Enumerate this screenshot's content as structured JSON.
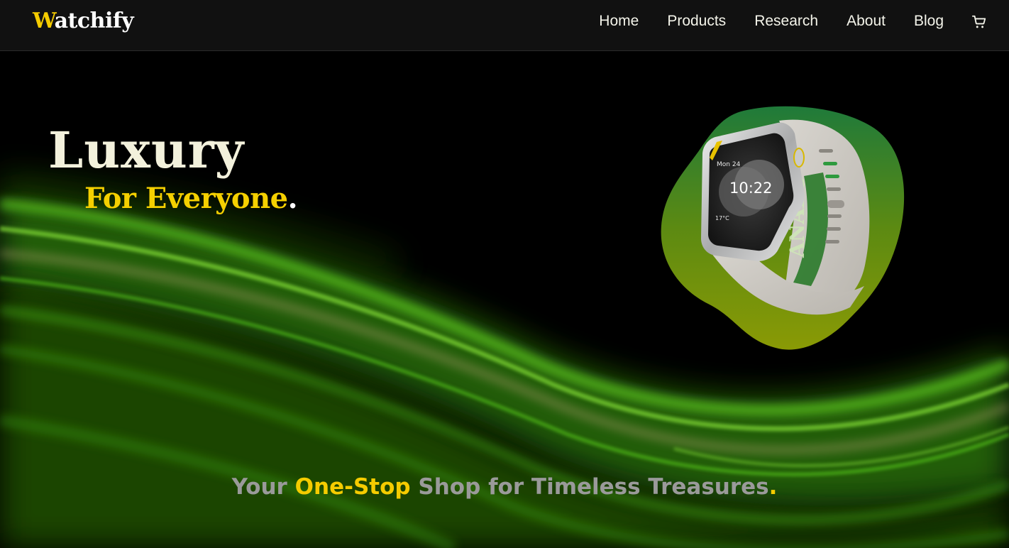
{
  "brand": {
    "logo_first": "W",
    "logo_rest": "atchify",
    "accent_color": "#f5cc00"
  },
  "nav": {
    "items": [
      {
        "label": "Home"
      },
      {
        "label": "Products"
      },
      {
        "label": "Research"
      },
      {
        "label": "About"
      },
      {
        "label": "Blog"
      }
    ],
    "cart_icon": "cart-icon"
  },
  "hero": {
    "title": "Luxury",
    "subtitle": "For Everyone",
    "subtitle_dot": ".",
    "tagline_part1": "Your ",
    "tagline_highlight": "One-Stop",
    "tagline_part2": " Shop for Timeless Treasures",
    "tagline_dot": "."
  },
  "watch": {
    "brand_text": "ANARC",
    "date": "Mon 24",
    "time": "10:22",
    "temperature": "17°C"
  }
}
